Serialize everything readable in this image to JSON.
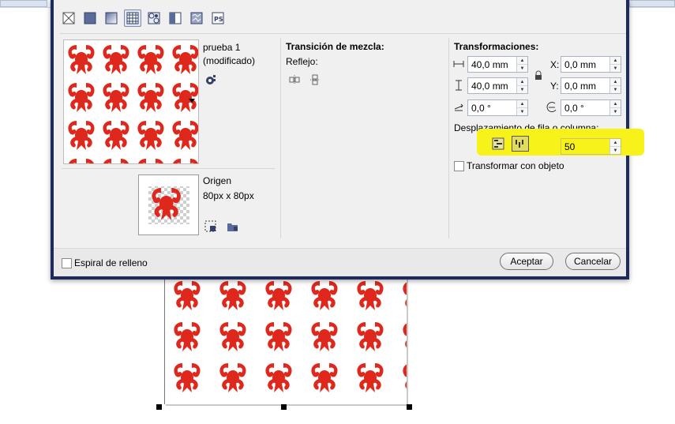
{
  "toolbar": {
    "icons": [
      "no-fill-icon",
      "uniform-fill-icon",
      "gradient-fill-icon",
      "pattern-fill-icon",
      "two-color-pattern-icon",
      "bitmap-pattern-icon",
      "texture-fill-icon",
      "postscript-fill-icon"
    ],
    "active_index": 3
  },
  "pattern": {
    "name": "prueba 1",
    "status": "(modificado)",
    "origin_label": "Origen",
    "origin_size": "80px x 80px",
    "color": "#e0271c"
  },
  "blend": {
    "title": "Transición de mezcla:",
    "reflection_label": "Reflejo:"
  },
  "transform": {
    "title": "Transformaciones:",
    "width": "40,0 mm",
    "height": "40,0 mm",
    "rotation": "0,0 °",
    "x_label": "X:",
    "x_value": "0,0 mm",
    "y_label": "Y:",
    "y_value": "0,0 mm",
    "skew_value": "0,0 °",
    "offset_label": "Desplazamiento de fila o columna:",
    "offset_value": "50",
    "transform_with_object": "Transformar con objeto"
  },
  "footer": {
    "spiral_label": "Espiral de relleno",
    "accept": "Aceptar",
    "cancel": "Cancelar"
  },
  "colors": {
    "highlight": "#f6f21a",
    "dialog_border": "#1e2a5c"
  }
}
